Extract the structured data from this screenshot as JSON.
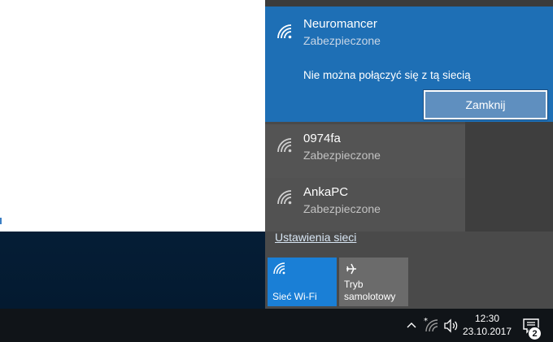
{
  "flyout": {
    "active_network": {
      "name": "Neuromancer",
      "status": "Zabezpieczone",
      "message": "Nie można połączyć się z tą siecią",
      "close_label": "Zamknij",
      "icon": "wifi-secured-icon"
    },
    "networks": [
      {
        "name": "0974fa",
        "status": "Zabezpieczone",
        "icon": "wifi-secured-icon"
      },
      {
        "name": "AnkaPC",
        "status": "Zabezpieczone",
        "icon": "wifi-secured-icon"
      }
    ],
    "settings_link": "Ustawienia sieci",
    "quick_actions": [
      {
        "label": "Sieć Wi-Fi",
        "icon": "wifi-icon",
        "active": true
      },
      {
        "label": "Tryb samolotowy",
        "icon": "airplane-icon",
        "active": false
      }
    ]
  },
  "taskbar": {
    "time": "12:30",
    "date": "23.10.2017",
    "notification_count": "2"
  },
  "colors": {
    "accent": "#1e6fb5",
    "tile_active": "#1a7fd6",
    "flyout_bg": "#4a4a4a",
    "taskbar_bg": "#101418"
  }
}
